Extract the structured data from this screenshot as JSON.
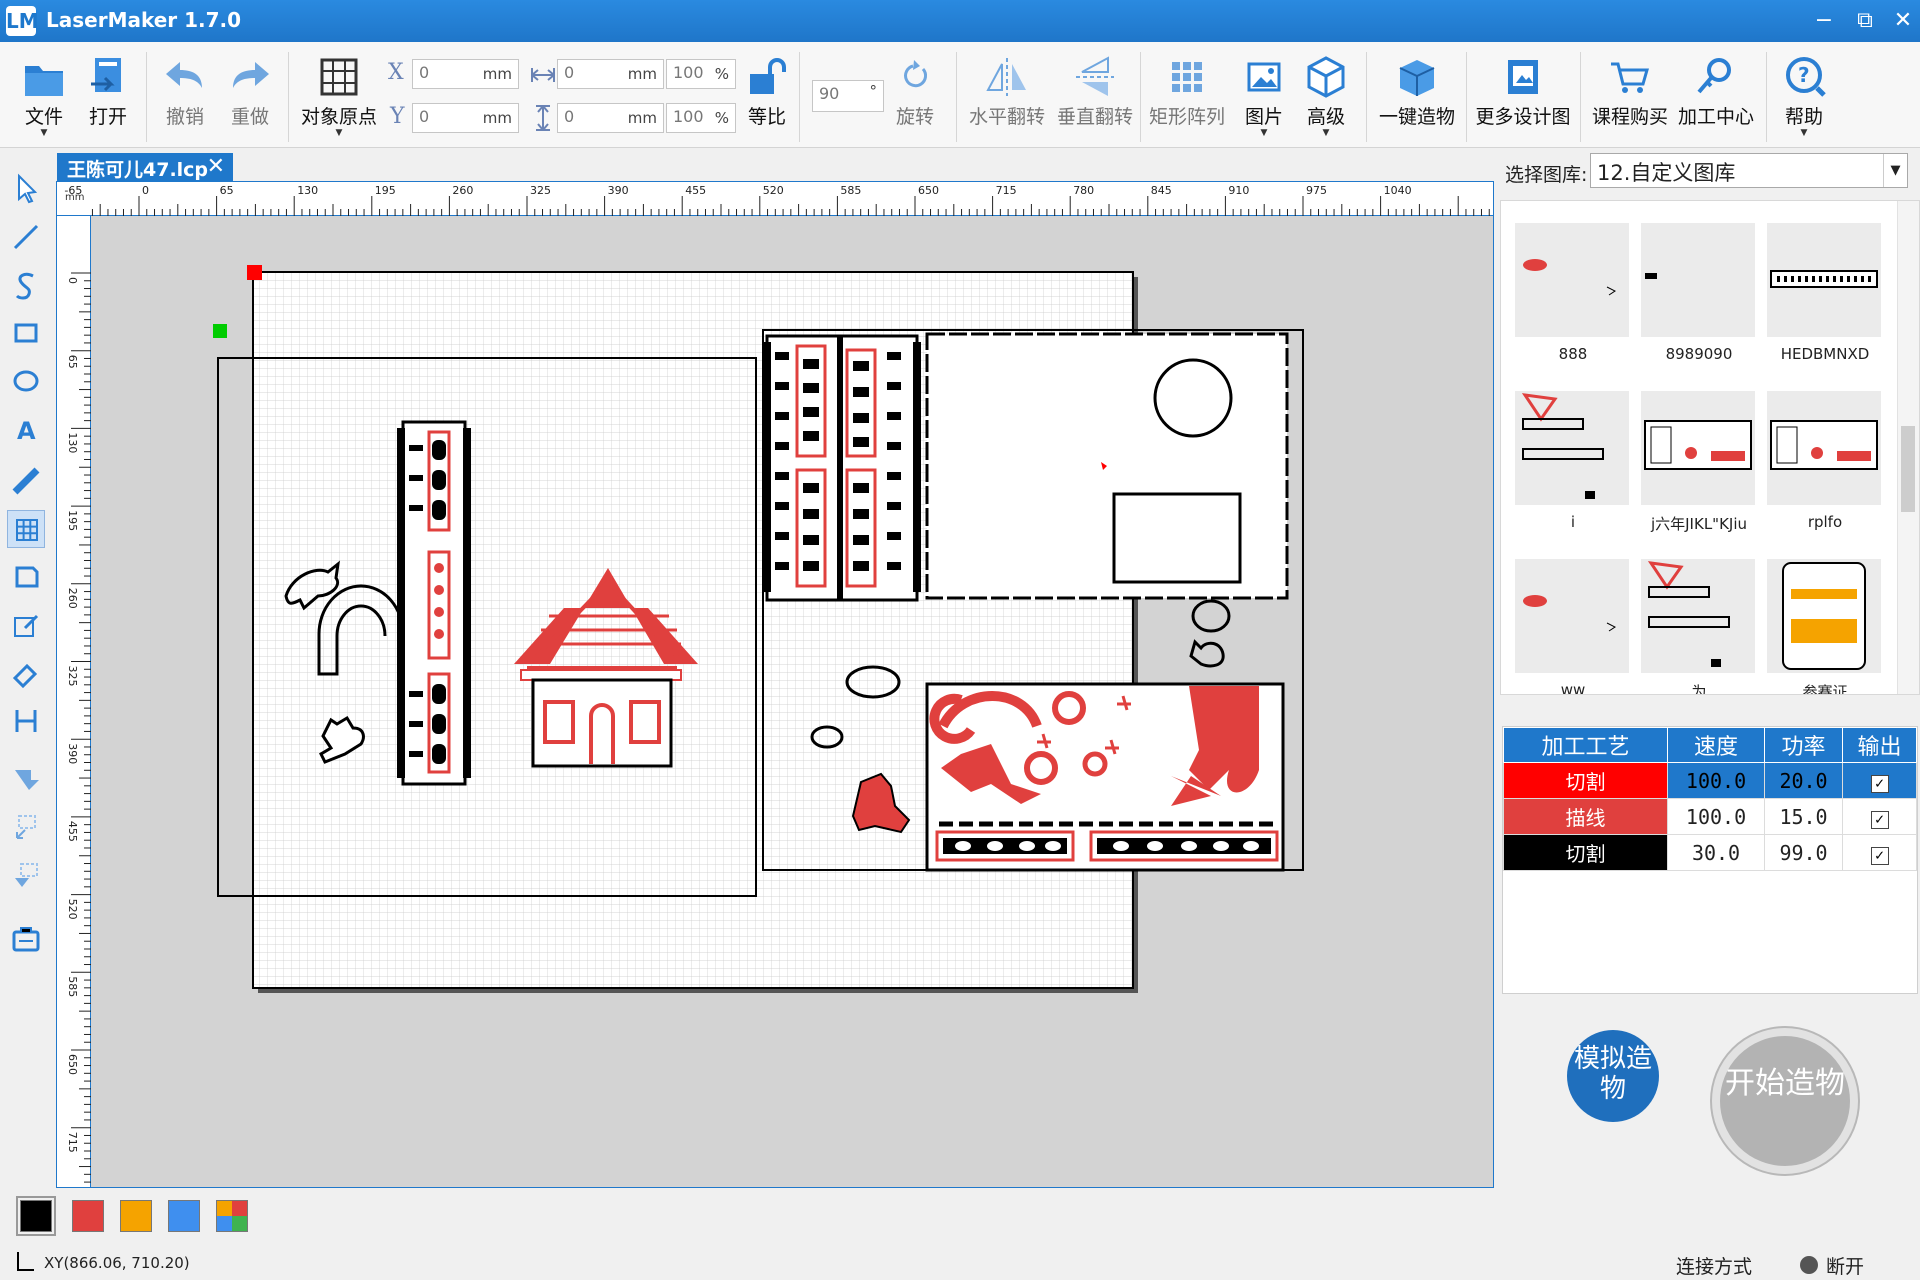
{
  "app": {
    "title": "LaserMaker 1.7.0",
    "logo_letters": "LM",
    "icon": "lasermaker-logo-icon"
  },
  "window_controls": {
    "minimize": "−",
    "maximize": "⧉",
    "close": "✕"
  },
  "toolbar": {
    "file": "文件",
    "open": "打开",
    "undo": "撤销",
    "redo": "重做",
    "object_origin": "对象原点",
    "x_label": "X",
    "y_label": "Y",
    "x_value": "0",
    "y_value": "0",
    "width_value": "0",
    "height_value": "0",
    "width_pct": "100",
    "height_pct": "100",
    "unit_mm": "mm",
    "unit_pct": "%",
    "proportional": "等比",
    "rotation_value": "90",
    "rotation_unit": "°",
    "rotate": "旋转",
    "flip_h": "水平翻转",
    "flip_v": "垂直翻转",
    "array": "矩形阵列",
    "image": "图片",
    "advanced": "高级",
    "one_click": "一键造物",
    "more_designs": "更多设计图",
    "course_buy": "课程购买",
    "process_center": "加工中心",
    "help": "帮助"
  },
  "document": {
    "tab_title": "王陈可儿47.lcp",
    "close": "✕"
  },
  "ruler": {
    "unit": "mm",
    "top_ticks": [
      "-65",
      "0",
      "65",
      "130",
      "195",
      "260",
      "325",
      "390",
      "455",
      "520",
      "585",
      "650",
      "715",
      "780",
      "845",
      "910",
      "975",
      "1040"
    ],
    "left_ticks": [
      "0",
      "65",
      "130",
      "195",
      "260",
      "325",
      "390",
      "455",
      "520",
      "585",
      "650",
      "715"
    ]
  },
  "gallery": {
    "label": "选择图库:",
    "selected": "12.自定义图库",
    "items": [
      {
        "caption": "888"
      },
      {
        "caption": "8989090"
      },
      {
        "caption": "HEDBMNXD"
      },
      {
        "caption": "i"
      },
      {
        "caption": "j六年JIKL\"KJiu"
      },
      {
        "caption": "rplfo"
      },
      {
        "caption": "ww"
      },
      {
        "caption": "为"
      },
      {
        "caption": "参赛证"
      }
    ]
  },
  "layers": {
    "headers": [
      "加工工艺",
      "速度",
      "功率",
      "输出"
    ],
    "rows": [
      {
        "process": "切割",
        "speed": "100.0",
        "power": "20.0",
        "output": "✓",
        "color": "#ff0000"
      },
      {
        "process": "描线",
        "speed": "100.0",
        "power": "15.0",
        "output": "✓",
        "color": "#e0403e"
      },
      {
        "process": "切割",
        "speed": "30.0",
        "power": "99.0",
        "output": "✓",
        "color": "#000000"
      }
    ]
  },
  "buttons": {
    "simulate": "模拟造物",
    "start": "开始造物"
  },
  "palette": [
    "#000000",
    "#e0403e",
    "#f5a300",
    "#3f8fef",
    "multicolor"
  ],
  "status": {
    "coords": "XY(866.06, 710.20)",
    "connection_label": "连接方式",
    "connection_state": "断开"
  },
  "colors": {
    "accent": "#1f78cb",
    "red_layer": "#e0403e",
    "cut_red": "#ff0000"
  }
}
